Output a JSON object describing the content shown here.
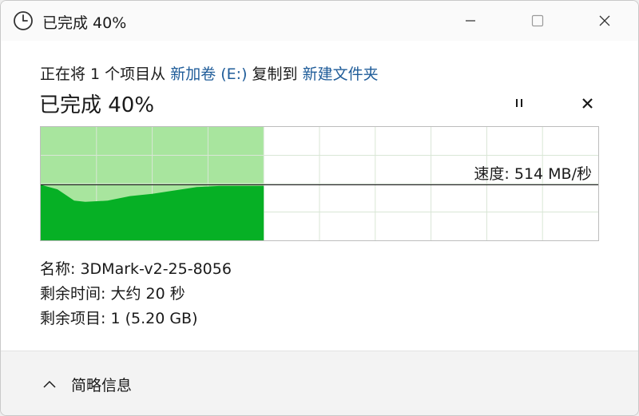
{
  "window": {
    "title": "已完成 40%"
  },
  "status": {
    "prefix": "正在将 1 个项目从 ",
    "source": "新加卷 (E:)",
    "middle": " 复制到 ",
    "destination": "新建文件夹"
  },
  "progress": {
    "heading": "已完成 40%",
    "percent": 40,
    "speed_label": "速度: 514 MB/秒"
  },
  "chart_data": {
    "type": "area",
    "title": "",
    "xlabel": "",
    "ylabel": "",
    "xlim": [
      0,
      100
    ],
    "ylim": [
      0,
      1
    ],
    "progress_percent": 40,
    "current_speed_level": 0.49,
    "x": [
      0,
      3,
      6,
      8,
      12,
      16,
      20,
      24,
      28,
      32,
      36,
      40
    ],
    "values": [
      0.49,
      0.45,
      0.35,
      0.34,
      0.35,
      0.39,
      0.41,
      0.44,
      0.47,
      0.48,
      0.48,
      0.48
    ],
    "colors": {
      "fill": "#06b025",
      "done_background": "#a8e59e",
      "grid": "#d9e6d6",
      "speed_line": "#1a1a1a"
    }
  },
  "details": {
    "name_label": "名称:",
    "name_value": "3DMark-v2-25-8056",
    "time_label": "剩余时间:",
    "time_value": "大约 20 秒",
    "items_label": "剩余项目:",
    "items_value": "1 (5.20 GB)"
  },
  "footer": {
    "toggle_label": "简略信息"
  },
  "icons": {
    "title": "clock-icon",
    "minimize": "minimize-icon",
    "maximize": "maximize-icon",
    "close": "close-icon",
    "pause": "pause-icon",
    "cancel": "cancel-icon",
    "collapse": "chevron-up-icon"
  }
}
